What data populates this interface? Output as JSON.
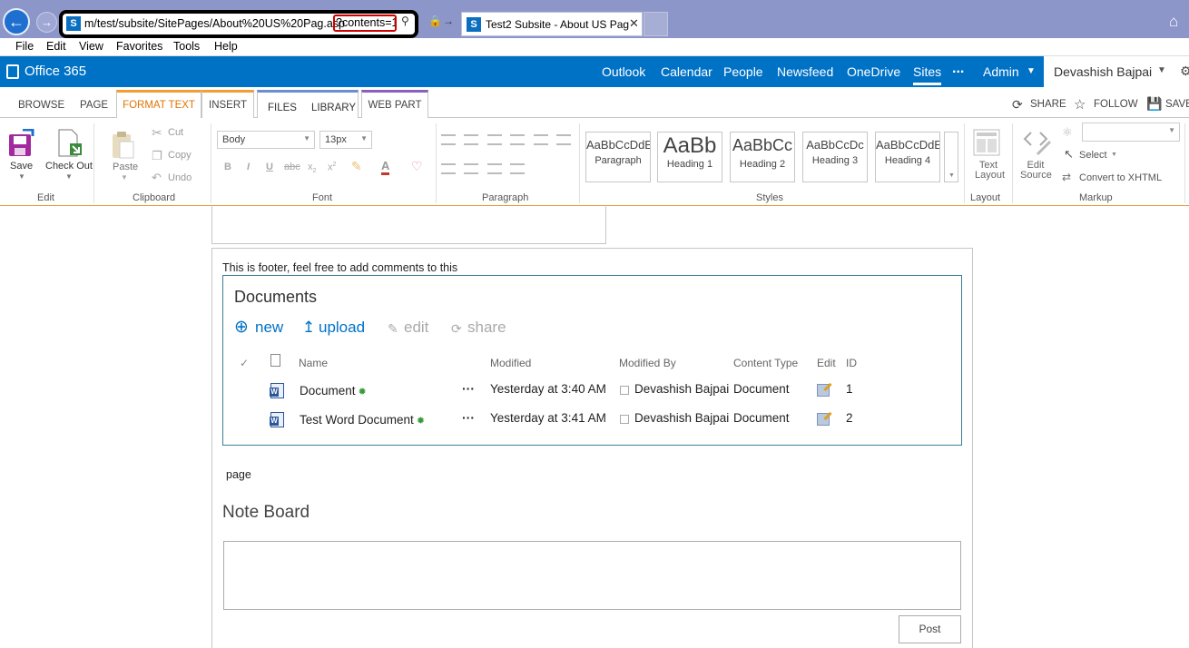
{
  "browser": {
    "address_text": "m/test/subsite/SitePages/About%20US%20Pag.asp",
    "address_highlight": "?contents=1",
    "tab_title": "Test2 Subsite - About US Pag",
    "menu": [
      "File",
      "Edit",
      "View",
      "Favorites",
      "Tools",
      "Help"
    ]
  },
  "suite": {
    "brand": "Office 365",
    "nav": [
      "Outlook",
      "Calendar",
      "People",
      "Newsfeed",
      "OneDrive",
      "Sites",
      "...",
      "Admin"
    ],
    "user": "Devashish Bajpai"
  },
  "ribbon_tabs": {
    "browse": "BROWSE",
    "page": "PAGE",
    "format_text": "FORMAT TEXT",
    "insert": "INSERT",
    "files": "FILES",
    "library": "LIBRARY",
    "web_part": "WEB PART",
    "share": "SHARE",
    "follow": "FOLLOW",
    "save": "SAVE"
  },
  "ribbon": {
    "save": "Save",
    "check_out": "Check Out",
    "edit_group": "Edit",
    "paste": "Paste",
    "cut": "Cut",
    "copy": "Copy",
    "undo": "Undo",
    "clipboard_group": "Clipboard",
    "font_name": "Body",
    "font_size": "13px",
    "font_group": "Font",
    "paragraph_group": "Paragraph",
    "styles": [
      {
        "sample": "AaBbCcDdE",
        "name": "Paragraph"
      },
      {
        "sample": "AaBb",
        "name": "Heading 1"
      },
      {
        "sample": "AaBbCc",
        "name": "Heading 2"
      },
      {
        "sample": "AaBbCcDc",
        "name": "Heading 3"
      },
      {
        "sample": "AaBbCcDdE",
        "name": "Heading 4"
      }
    ],
    "styles_group": "Styles",
    "text_layout": "Text Layout",
    "layout_group": "Layout",
    "edit_source": "Edit Source",
    "select": "Select",
    "convert_xhtml": "Convert to XHTML",
    "markup_group": "Markup"
  },
  "content": {
    "footer_text": "This is footer, feel free to add comments to this",
    "documents_title": "Documents",
    "commands": {
      "new": "new",
      "upload": "upload",
      "edit": "edit",
      "share": "share"
    },
    "columns": [
      "Name",
      "Modified",
      "Modified By",
      "Content Type",
      "Edit",
      "ID"
    ],
    "rows": [
      {
        "name": "Document",
        "modified": "Yesterday at 3:40 AM",
        "modified_by": "Devashish Bajpai",
        "content_type": "Document",
        "id": "1"
      },
      {
        "name": "Test Word Document",
        "modified": "Yesterday at 3:41 AM",
        "modified_by": "Devashish Bajpai",
        "content_type": "Document",
        "id": "2"
      }
    ],
    "page_text": "page",
    "note_board_title": "Note Board",
    "post_button": "Post"
  }
}
